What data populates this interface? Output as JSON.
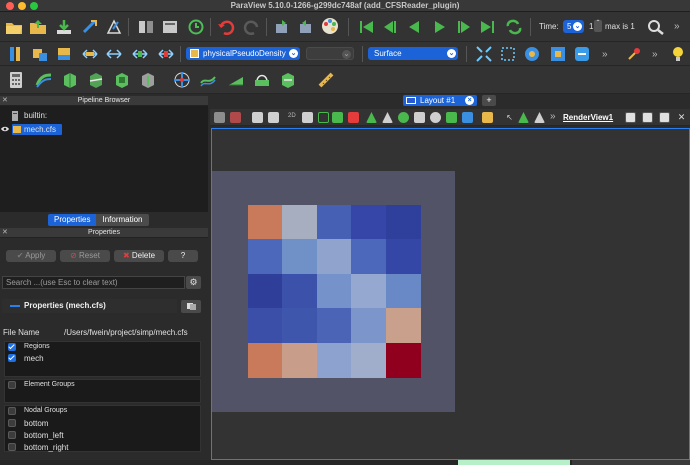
{
  "window": {
    "title": "ParaView 5.10.0-1266-g299dc748af (add_CFSReader_plugin)"
  },
  "toolbar": {
    "time_label": "Time:",
    "time_value": "5",
    "time_index": "1",
    "max_label": "max is 1",
    "variable_combo": "physicalPseudoDensity",
    "representation_combo": "Surface",
    "overflow": "»"
  },
  "pipeline_browser": {
    "title": "Pipeline Browser",
    "items": [
      {
        "label": "builtin:"
      },
      {
        "label": "mech.cfs"
      }
    ]
  },
  "properties_panel": {
    "tabs": [
      "Properties",
      "Information"
    ],
    "title": "Properties",
    "apply": "Apply",
    "reset": "Reset",
    "delete": "Delete",
    "help": "?",
    "search_placeholder": "Search ...(use Esc to clear text)",
    "section_title": "Properties (mech.cfs)",
    "file_name_label": "File Name",
    "file_name_value": "/Users/fwein/project/simp/mech.cfs",
    "regions_label": "Regions",
    "regions": [
      "mech"
    ],
    "element_groups_label": "Element Groups",
    "nodal_groups_label": "Nodal Groups",
    "nodal_groups": [
      "bottom",
      "bottom_left",
      "bottom_right"
    ]
  },
  "layout": {
    "tab_label": "Layout #1",
    "close": "×",
    "add": "+",
    "view_name": "RenderView1",
    "view_2d": "2D"
  },
  "render": {
    "grid_colors": [
      [
        "#c87a5a",
        "#a6aec0",
        "#4660b4",
        "#3546a8",
        "#2f3f9c"
      ],
      [
        "#4c68ba",
        "#7090c8",
        "#8fa3cc",
        "#4c68ba",
        "#3547a6"
      ],
      [
        "#2f3e98",
        "#3b51aa",
        "#7592cb",
        "#95a8cf",
        "#6888c6"
      ],
      [
        "#3b4fa8",
        "#3e56ac",
        "#4b64b6",
        "#7c96cb",
        "#c8a08c"
      ],
      [
        "#c87a5a",
        "#c89e8a",
        "#8da2cf",
        "#a0aecc",
        "#90001e"
      ]
    ]
  }
}
